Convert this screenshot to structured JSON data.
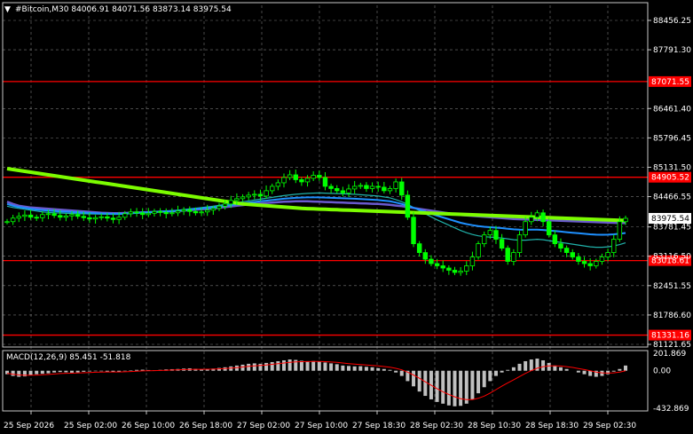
{
  "header": {
    "symbol_line": "#Bitcoin,M30  84006.91 84071.56 83873.14 83975.54",
    "macd_title": "MACD(12,26,9) 85.451 -51.818"
  },
  "colors": {
    "background": "#000000",
    "grid": "#c8c8c8",
    "candle": "#00ff00",
    "level": "#ff0000",
    "ma_fast": "#1e90ff",
    "ma_mid": "#6a5acd",
    "ma_slow": "#7cfc00",
    "ma_cyan": "#20b2aa",
    "macd_hist": "#c0c0c0",
    "macd_signal": "#ff0000",
    "price_tag": "#ffffff"
  },
  "chart_data": {
    "type": "candlestick",
    "symbol": "#Bitcoin",
    "timeframe": "M30",
    "ohlc_last": {
      "open": 84006.91,
      "high": 84071.56,
      "low": 83873.14,
      "close": 83975.54
    },
    "y_ticks": [
      "88456.25",
      "87791.30",
      "86461.40",
      "85796.45",
      "85131.50",
      "84466.55",
      "83781.45",
      "83116.50",
      "82451.55",
      "81786.60",
      "81121.65"
    ],
    "ylim": [
      81121.65,
      88456.25
    ],
    "x_ticks": [
      "25 Sep 2026",
      "25 Sep 02:00",
      "26 Sep 10:00",
      "26 Sep 18:00",
      "27 Sep 02:00",
      "27 Sep 10:00",
      "27 Sep 18:30",
      "28 Sep 02:30",
      "28 Sep 10:30",
      "28 Sep 18:30",
      "29 Sep 02:30"
    ],
    "levels": [
      {
        "label": "87071.55",
        "value": 87071.55
      },
      {
        "label": "84905.52",
        "value": 84905.52
      },
      {
        "label": "83018.61",
        "value": 83018.61
      },
      {
        "label": "81331.16",
        "value": 81331.16
      }
    ],
    "current_price": {
      "label": "83975.54",
      "value": 83975.54
    },
    "closes": [
      83900,
      83980,
      84020,
      84050,
      84000,
      83990,
      84060,
      84080,
      84040,
      84000,
      84030,
      84060,
      84020,
      83990,
      83960,
      83990,
      84010,
      83980,
      83950,
      84000,
      84080,
      84120,
      84100,
      84060,
      84090,
      84130,
      84110,
      84080,
      84100,
      84140,
      84170,
      84130,
      84100,
      84120,
      84160,
      84200,
      84250,
      84300,
      84380,
      84420,
      84460,
      84500,
      84520,
      84480,
      84600,
      84700,
      84780,
      84900,
      84960,
      84850,
      84800,
      84880,
      84950,
      84900,
      84700,
      84650,
      84600,
      84550,
      84640,
      84700,
      84720,
      84650,
      84700,
      84680,
      84600,
      84650,
      84800,
      84500,
      84000,
      83400,
      83200,
      83050,
      82950,
      82900,
      82850,
      82800,
      82750,
      82780,
      82900,
      83100,
      83400,
      83600,
      83700,
      83500,
      83300,
      83000,
      83200,
      83600,
      83900,
      84000,
      84100,
      83900,
      83600,
      83400,
      83300,
      83200,
      83100,
      83000,
      82950,
      82900,
      83000,
      83100,
      83200,
      83500,
      83900,
      83975.54
    ],
    "ma_slow": [
      85100,
      85080,
      85060,
      85040,
      85020,
      85000,
      84980,
      84960,
      84940,
      84920,
      84900,
      84880,
      84860,
      84840,
      84820,
      84800,
      84780,
      84760,
      84740,
      84720,
      84700,
      84680,
      84660,
      84640,
      84620,
      84600,
      84580,
      84560,
      84540,
      84520,
      84500,
      84480,
      84460,
      84440,
      84420,
      84400,
      84380,
      84360,
      84340,
      84320,
      84300,
      84290,
      84280,
      84270,
      84260,
      84250,
      84240,
      84230,
      84220,
      84210,
      84200,
      84195,
      84190,
      84185,
      84180,
      84175,
      84170,
      84165,
      84160,
      84155,
      84150,
      84145,
      84140,
      84135,
      84130,
      84125,
      84120,
      84115,
      84110,
      84105,
      84100,
      84095,
      84090,
      84085,
      84080,
      84075,
      84070,
      84065,
      84060,
      84055,
      84050,
      84045,
      84040,
      84035,
      84030,
      84025,
      84020,
      84015,
      84010,
      84005,
      84000,
      83995,
      83990,
      83985,
      83980,
      83975,
      83970,
      83965,
      83960,
      83955,
      83950,
      83945,
      83940,
      83935,
      83930,
      83925
    ],
    "ma_mid": [
      84350,
      84300,
      84260,
      84240,
      84220,
      84210,
      84200,
      84190,
      84180,
      84170,
      84160,
      84150,
      84140,
      84130,
      84120,
      84110,
      84100,
      84095,
      84090,
      84090,
      84095,
      84100,
      84105,
      84110,
      84115,
      84120,
      84125,
      84130,
      84135,
      84140,
      84150,
      84160,
      84170,
      84180,
      84190,
      84200,
      84215,
      84230,
      84245,
      84260,
      84275,
      84290,
      84300,
      84310,
      84320,
      84330,
      84340,
      84350,
      84355,
      84360,
      84360,
      84360,
      84355,
      84350,
      84345,
      84340,
      84335,
      84330,
      84325,
      84320,
      84315,
      84310,
      84305,
      84300,
      84290,
      84280,
      84265,
      84250,
      84230,
      84210,
      84190,
      84170,
      84150,
      84130,
      84110,
      84090,
      84070,
      84050,
      84040,
      84030,
      84020,
      84010,
      84000,
      83990,
      83980,
      83970,
      83960,
      83955,
      83950,
      83945,
      83940,
      83935,
      83930,
      83925,
      83920,
      83915,
      83910,
      83905,
      83900,
      83895,
      83890,
      83885,
      83880,
      83875,
      83870,
      83868
    ],
    "ma_fast": [
      84250,
      84220,
      84200,
      84180,
      84160,
      84140,
      84120,
      84110,
      84100,
      84095,
      84090,
      84085,
      84080,
      84078,
      84075,
      84072,
      84070,
      84068,
      84066,
      84065,
      84070,
      84080,
      84090,
      84100,
      84110,
      84120,
      84130,
      84140,
      84150,
      84160,
      84175,
      84190,
      84205,
      84220,
      84235,
      84250,
      84270,
      84290,
      84310,
      84330,
      84350,
      84370,
      84390,
      84410,
      84430,
      84450,
      84470,
      84490,
      84505,
      84520,
      84530,
      84540,
      84545,
      84550,
      84545,
      84540,
      84535,
      84530,
      84525,
      84520,
      84510,
      84500,
      84490,
      84480,
      84460,
      84440,
      84400,
      84350,
      84290,
      84220,
      84150,
      84080,
      84010,
      83940,
      83880,
      83820,
      83760,
      83700,
      83650,
      83610,
      83580,
      83560,
      83550,
      83540,
      83530,
      83510,
      83490,
      83480,
      83480,
      83490,
      83500,
      83490,
      83470,
      83450,
      83430,
      83410,
      83390,
      83370,
      83350,
      83330,
      83320,
      83320,
      83330,
      83350,
      83380,
      83420
    ],
    "macd_yticks": [
      "201.869",
      "0.00",
      "-432.869"
    ],
    "macd_ylim": [
      -432.869,
      201.869
    ],
    "macd_hist": [
      -40,
      -60,
      -70,
      -65,
      -50,
      -40,
      -35,
      -30,
      -20,
      -15,
      -18,
      -22,
      -20,
      -12,
      -8,
      -5,
      -6,
      -10,
      -15,
      -12,
      -5,
      5,
      10,
      12,
      8,
      5,
      10,
      15,
      18,
      20,
      25,
      28,
      22,
      18,
      20,
      25,
      32,
      40,
      50,
      60,
      70,
      80,
      85,
      80,
      90,
      100,
      110,
      120,
      130,
      125,
      115,
      110,
      112,
      108,
      95,
      85,
      75,
      60,
      55,
      50,
      52,
      45,
      40,
      30,
      20,
      10,
      -20,
      -60,
      -120,
      -180,
      -240,
      -290,
      -330,
      -360,
      -380,
      -400,
      -410,
      -405,
      -380,
      -330,
      -260,
      -190,
      -120,
      -60,
      -20,
      10,
      40,
      80,
      110,
      130,
      140,
      120,
      90,
      60,
      40,
      20,
      0,
      -20,
      -40,
      -60,
      -70,
      -60,
      -40,
      -10,
      20,
      60
    ],
    "macd_signal": [
      -30,
      -40,
      -48,
      -52,
      -52,
      -50,
      -47,
      -43,
      -38,
      -33,
      -30,
      -28,
      -26,
      -23,
      -20,
      -17,
      -15,
      -14,
      -14,
      -14,
      -12,
      -9,
      -5,
      -2,
      0,
      1,
      3,
      5,
      8,
      10,
      13,
      16,
      17,
      17,
      18,
      19,
      22,
      25,
      30,
      36,
      43,
      50,
      57,
      62,
      67,
      74,
      81,
      89,
      97,
      102,
      105,
      106,
      107,
      107,
      105,
      101,
      96,
      89,
      82,
      76,
      71,
      66,
      61,
      55,
      48,
      40,
      28,
      10,
      -16,
      -49,
      -87,
      -128,
      -168,
      -207,
      -242,
      -274,
      -301,
      -322,
      -333,
      -333,
      -318,
      -293,
      -258,
      -218,
      -178,
      -140,
      -104,
      -67,
      -31,
      1,
      29,
      47,
      56,
      57,
      54,
      47,
      38,
      26,
      13,
      -1,
      -15,
      -24,
      -27,
      -24,
      -15,
      -1
    ]
  }
}
